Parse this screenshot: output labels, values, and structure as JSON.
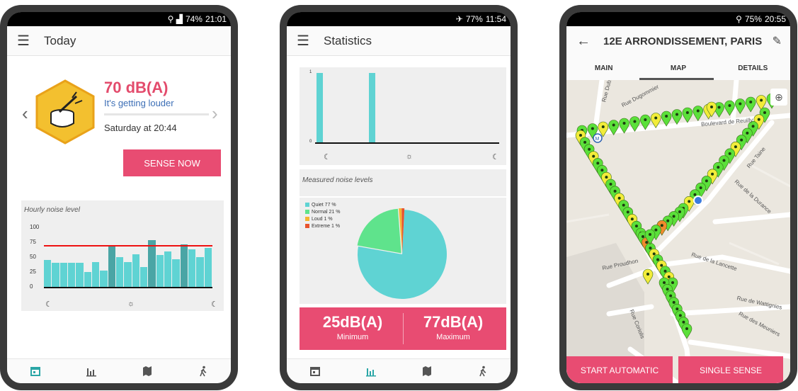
{
  "phone1": {
    "status": {
      "battery": "74%",
      "time": "21:01"
    },
    "title": "Today",
    "reading": {
      "level": "70 dB(A)",
      "trend": "It's getting louder",
      "time": "Saturday at 20:44"
    },
    "sense_button": "SENSE NOW",
    "chart_title": "Hourly noise level",
    "chart_data": {
      "type": "bar",
      "title": "Hourly noise level",
      "yticks": [
        "100",
        "75",
        "50",
        "25",
        "0"
      ],
      "ylim": [
        0,
        100
      ],
      "threshold": 70,
      "values": [
        45,
        40,
        41,
        40,
        40,
        25,
        42,
        27,
        70,
        50,
        42,
        55,
        33,
        78,
        53,
        60,
        46,
        72,
        63,
        50,
        65
      ],
      "highlighted_bars": [
        8,
        13,
        17
      ]
    }
  },
  "phone2": {
    "status": {
      "battery": "77%",
      "time": "11:54"
    },
    "title": "Statistics",
    "chart_data": [
      {
        "type": "bar",
        "yticks": [
          "1",
          "0"
        ],
        "ylim": [
          0,
          1
        ],
        "values": [
          1,
          1
        ]
      },
      {
        "type": "pie",
        "title": "Measured noise levels",
        "slices": [
          {
            "label": "Quiet 77 %",
            "value": 77,
            "color": "#5fd3d3"
          },
          {
            "label": "Normal 21 %",
            "value": 21,
            "color": "#5fe38c"
          },
          {
            "label": "Loud 1 %",
            "value": 1,
            "color": "#f5b531"
          },
          {
            "label": "Extreme 1 %",
            "value": 1,
            "color": "#e8532d"
          }
        ]
      }
    ],
    "stats": [
      {
        "value": "25dB(A)",
        "label": "Minimum"
      },
      {
        "value": "77dB(A)",
        "label": "Maximum"
      }
    ]
  },
  "phone3": {
    "status": {
      "battery": "75%",
      "time": "20:55"
    },
    "title": "12E ARRONDISSEMENT, PARIS",
    "tabs": [
      "MAIN",
      "MAP",
      "DETAILS"
    ],
    "active_tab": "MAP",
    "streets": [
      "Rue Dugommier",
      "Boulevard de Reuilly",
      "Rue Taine",
      "Rue de la Durance",
      "Rue de la Lancette",
      "Rue Proudhon",
      "Rue de Wattignies",
      "Rue des Meuniers",
      "Rue Coriolis",
      "Rue Dub."
    ],
    "buttons": {
      "start": "START AUTOMATIC",
      "single": "SINGLE SENSE"
    }
  }
}
